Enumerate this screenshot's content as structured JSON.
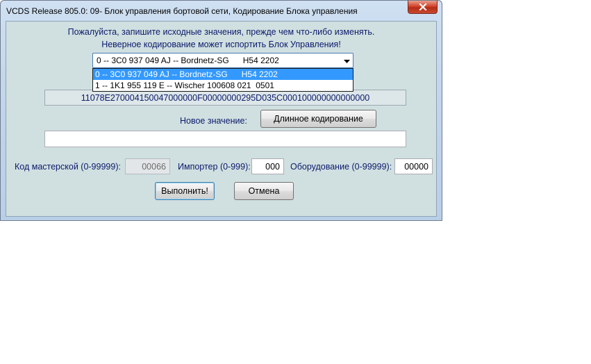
{
  "window": {
    "title": "VCDS Release 805.0: 09- Блок управления бортовой сети,  Кодирование Блока управления"
  },
  "message": {
    "line1": "Пожалуйста, запишите исходные значения, прежде чем что-либо изменять.",
    "line2": "Неверное кодирование может испортить Блок Управления!"
  },
  "module_select": {
    "selected": "0 -- 3C0 937 049 AJ -- Bordnetz-SG      H54 2202",
    "options": [
      "0 -- 3C0 937 049 AJ -- Bordnetz-SG      H54 2202",
      "1 -- 1K1 955 119 E -- Wischer 100608 021  0501"
    ],
    "highlighted_index": 0
  },
  "current_coding": "11078E270004150047000000F00000000295D035C000100000000000000",
  "new_value": {
    "label": "Новое значение:",
    "value": "",
    "long_coding_button": "Длинное кодирование"
  },
  "fields": {
    "workshop_label": "Код мастерской (0-99999):",
    "workshop_value": "00066",
    "importer_label": "Импортер (0-999):",
    "importer_value": "000",
    "equipment_label": "Оборудование (0-99999):",
    "equipment_value": "00000"
  },
  "buttons": {
    "execute": "Выполнить!",
    "cancel": "Отмена"
  },
  "colors": {
    "client_bg": "#d0dfe0",
    "label_text": "#0b1a6b",
    "selection": "#3399ff",
    "close_button": "#c8432a"
  },
  "icons": {
    "close": "close-x-icon",
    "dropdown": "chevron-down-icon"
  }
}
